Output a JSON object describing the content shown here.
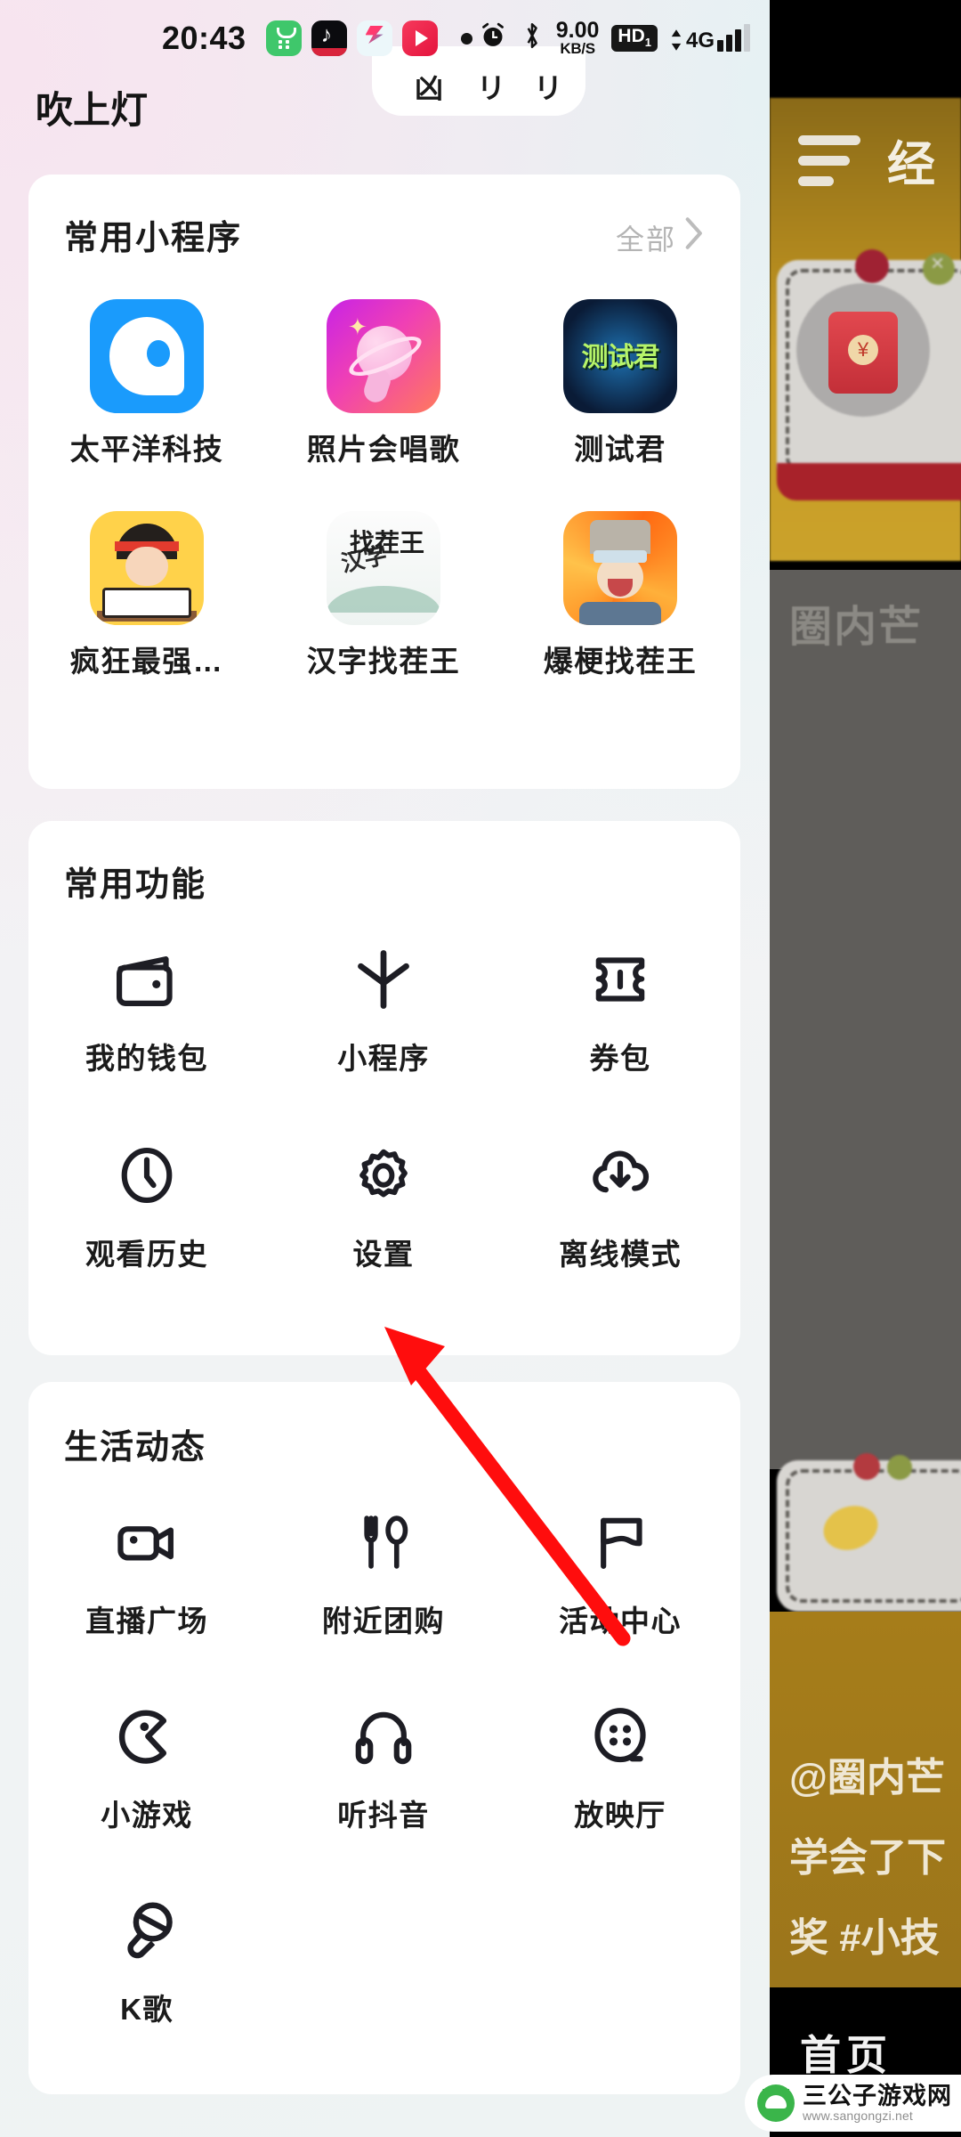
{
  "status_bar": {
    "time": "20:43",
    "app_icons": [
      "wechat-channels-icon",
      "douyin-icon",
      "kuaishou-icon",
      "video-play-icon"
    ],
    "recording_dot": "•",
    "alarm_icon": "alarm-clock-icon",
    "bluetooth_icon": "bluetooth-icon",
    "net_speed": "9.00",
    "net_speed_unit": "KB/S",
    "hd_badge": "HD",
    "hd_sub": "1",
    "network_type": "4G",
    "signal_bars": 3
  },
  "top_cut_row": {
    "title": "吹上灯",
    "card_text": "凶"
  },
  "mini_programs": {
    "title": "常用小程序",
    "all_label": "全部",
    "chevron": "chevron-right-icon",
    "items": [
      {
        "label": "太平洋科技",
        "icon": "pacific-tech-icon"
      },
      {
        "label": "照片会唱歌",
        "icon": "photo-sings-icon"
      },
      {
        "label": "测试君",
        "icon": "test-jun-icon"
      },
      {
        "label": "疯狂最强…",
        "icon": "crazy-strongest-icon"
      },
      {
        "label": "汉字找茬王",
        "icon": "hanzi-find-fault-icon"
      },
      {
        "label": "爆梗找茬王",
        "icon": "baogeng-find-fault-icon"
      }
    ]
  },
  "common_functions": {
    "title": "常用功能",
    "items": [
      {
        "label": "我的钱包",
        "icon": "wallet-icon"
      },
      {
        "label": "小程序",
        "icon": "mini-program-asterisk-icon"
      },
      {
        "label": "券包",
        "icon": "coupon-ticket-icon"
      },
      {
        "label": "观看历史",
        "icon": "clock-history-icon"
      },
      {
        "label": "设置",
        "icon": "gear-settings-icon"
      },
      {
        "label": "离线模式",
        "icon": "cloud-download-icon"
      }
    ]
  },
  "life_dynamics": {
    "title": "生活动态",
    "items": [
      {
        "label": "直播广场",
        "icon": "video-camera-icon"
      },
      {
        "label": "附近团购",
        "icon": "fork-spoon-icon"
      },
      {
        "label": "活动中心",
        "icon": "flag-icon"
      },
      {
        "label": "小游戏",
        "icon": "pacman-game-icon"
      },
      {
        "label": "听抖音",
        "icon": "headphones-icon"
      },
      {
        "label": "放映厅",
        "icon": "film-reel-icon"
      },
      {
        "label": "K歌",
        "icon": "microphone-icon"
      }
    ]
  },
  "annotation": {
    "arrow_color": "#ff0d0d",
    "points_to": "设置"
  },
  "background_app": {
    "menu_icon": "hamburger-menu-icon",
    "header_text": "经",
    "envelope_icon": "red-envelope-icon",
    "overlay_text": "圈内芒",
    "caption_line1": "@圈内芒",
    "caption_line2": "学会了下",
    "caption_line3": "奖 #小技",
    "tab_home": "首页"
  },
  "watermark": {
    "icon": "android-robot-icon",
    "site_name": "三公子游戏网",
    "site_url": "www.sangongzi.net"
  },
  "colors": {
    "accent_red": "#ff0d0d",
    "card_bg": "#ffffff",
    "text_primary": "#1b1b1b",
    "text_muted": "#b4b4b4"
  }
}
